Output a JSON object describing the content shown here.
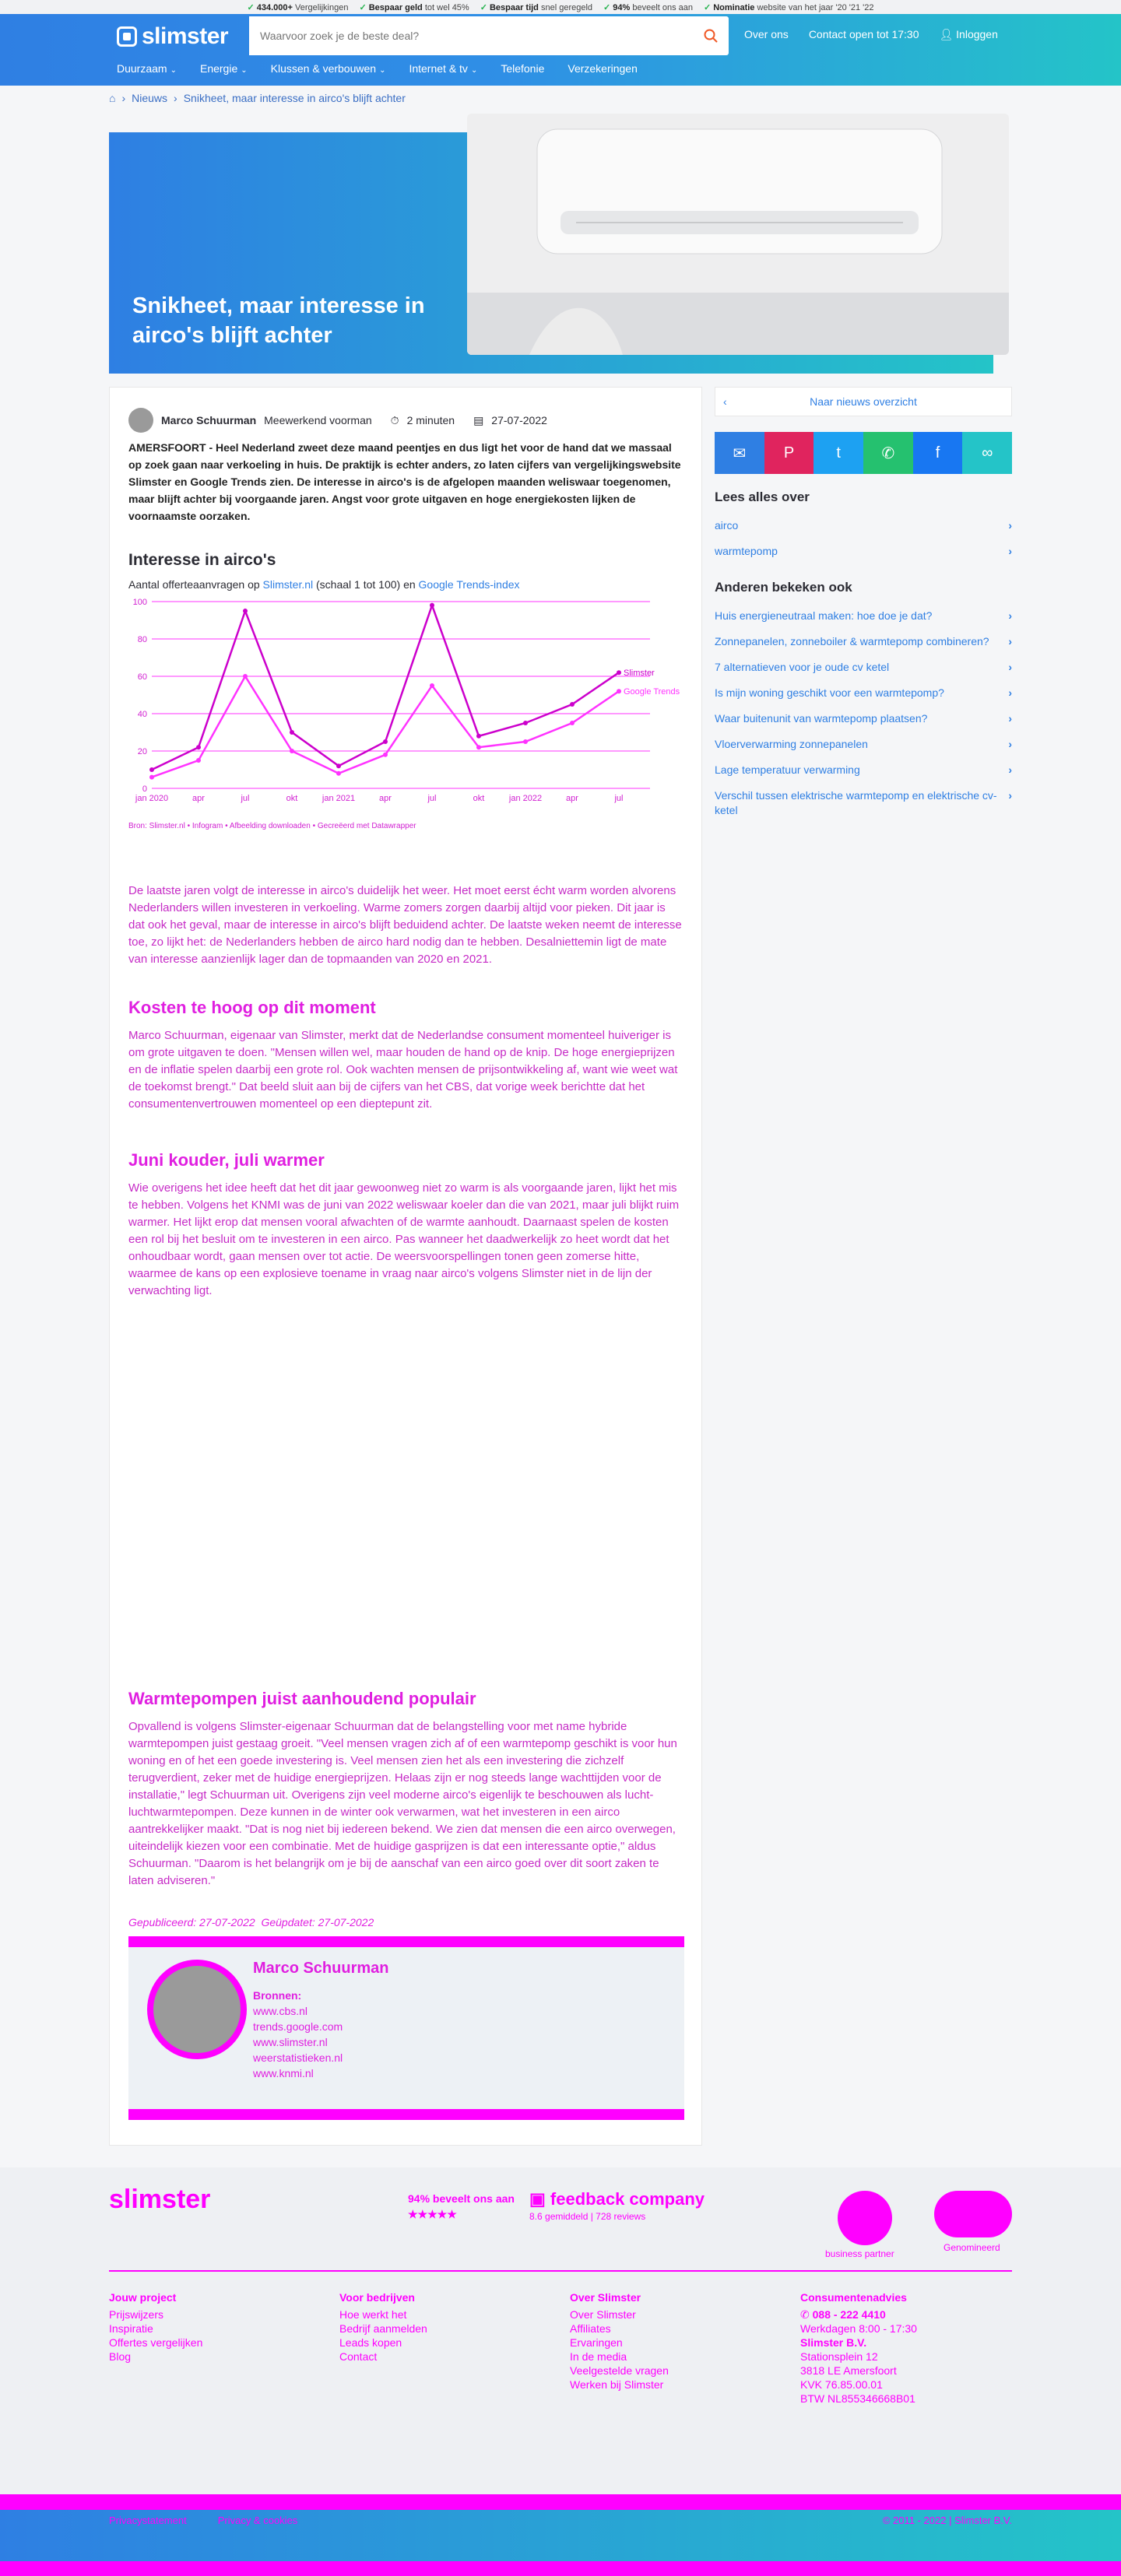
{
  "topbar": [
    {
      "bold": "434.000+",
      "text": "Vergelijkingen"
    },
    {
      "bold": "Bespaar geld",
      "text": "tot wel 45%"
    },
    {
      "bold": "Bespaar tijd",
      "text": "snel geregeld"
    },
    {
      "bold": "94%",
      "text": "beveelt ons aan"
    },
    {
      "bold": "Nominatie",
      "text": "website van het jaar '20 '21 '22"
    }
  ],
  "header": {
    "logo": "slimster",
    "search_placeholder": "Waarvoor zoek je de beste deal?",
    "links": [
      "Over ons",
      "Contact open tot 17:30",
      "Inloggen"
    ],
    "nav": [
      "Duurzaam",
      "Energie",
      "Klussen & verbouwen",
      "Internet & tv",
      "Telefonie",
      "Verzekeringen"
    ]
  },
  "breadcrumb": {
    "items": [
      "Nieuws",
      "Snikheet, maar interesse in airco's blijft achter"
    ]
  },
  "hero": {
    "title": "Snikheet, maar interesse in airco's blijft achter"
  },
  "article": {
    "author": "Marco Schuurman",
    "role": "Meewerkend voorman",
    "read_time": "2 minuten",
    "date": "27-07-2022",
    "intro": "AMERSFOORT - Heel Nederland zweet deze maand peentjes en dus ligt het voor de hand dat we massaal op zoek gaan naar verkoeling in huis. De praktijk is echter anders, zo laten cijfers van vergelijkingswebsite Slimster en Google Trends zien. De interesse in airco's is de afgelopen maanden weliswaar toegenomen, maar blijft achter bij voorgaande jaren. Angst voor grote uitgaven en hoge energiekosten lijken de voornaamste oorzaken.",
    "chart_title": "Interesse in airco's",
    "chart_sub_pre": "Aantal offerteaanvragen op",
    "chart_sub_link1": "Slimster.nl",
    "chart_sub_mid": "(schaal 1 tot 100) en",
    "chart_sub_link2": "Google Trends-index",
    "chart_source": "Bron: Slimster.nl • Infogram • Afbeelding downloaden • Gecreëerd met Datawrapper",
    "p1": "De laatste jaren volgt de interesse in airco's duidelijk het weer. Het moet eerst écht warm worden alvorens Nederlanders willen investeren in verkoeling. Warme zomers zorgen daarbij altijd voor pieken. Dit jaar is dat ook het geval, maar de interesse in airco's blijft beduidend achter. De laatste weken neemt de interesse toe, zo lijkt het: de Nederlanders hebben de airco hard nodig dan te hebben. Desalniettemin ligt de mate van interesse aanzienlijk lager dan de topmaanden van 2020 en 2021.",
    "h_kosten": "Kosten te hoog op dit moment",
    "p2": "Marco Schuurman, eigenaar van Slimster, merkt dat de Nederlandse consument momenteel huiveriger is om grote uitgaven te doen. \"Mensen willen wel, maar houden de hand op de knip. De hoge energieprijzen en de inflatie spelen daarbij een grote rol. Ook wachten mensen de prijsontwikkeling af, want wie weet wat de toekomst brengt.\" Dat beeld sluit aan bij de cijfers van het CBS, dat vorige week berichtte dat het consumentenvertrouwen momenteel op een dieptepunt zit.",
    "h_juni": "Juni kouder, juli warmer",
    "p3": "Wie overigens het idee heeft dat het dit jaar gewoonweg niet zo warm is als voorgaande jaren, lijkt het mis te hebben. Volgens het KNMI was de juni van 2022 weliswaar koeler dan die van 2021, maar juli blijkt ruim warmer. Het lijkt erop dat mensen vooral afwachten of de warmte aanhoudt. Daarnaast spelen de kosten een rol bij het besluit om te investeren in een airco. Pas wanneer het daadwerkelijk zo heet wordt dat het onhoudbaar wordt, gaan mensen over tot actie. De weersvoorspellingen tonen geen zomerse hitte, waarmee de kans op een explosieve toename in vraag naar airco's volgens Slimster niet in de lijn der verwachting ligt.",
    "h_warmte": "Warmtepompen juist aanhoudend populair",
    "p4": "Opvallend is volgens Slimster-eigenaar Schuurman dat de belangstelling voor met name hybride warmtepompen juist gestaag groeit. \"Veel mensen vragen zich af of een warmtepomp geschikt is voor hun woning en of het een goede investering is. Veel mensen zien het als een investering die zichzelf terugverdient, zeker met de huidige energieprijzen. Helaas zijn er nog steeds lange wachttijden voor de installatie,\" legt Schuurman uit. Overigens zijn veel moderne airco's eigenlijk te beschouwen als lucht-luchtwarmtepompen. Deze kunnen in de winter ook verwarmen, wat het investeren in een airco aantrekkelijker maakt. \"Dat is nog niet bij iedereen bekend. We zien dat mensen die een airco overwegen, uiteindelijk kiezen voor een combinatie. Met de huidige gasprijzen is dat een interessante optie,\" aldus Schuurman. \"Daarom is het belangrijk om je bij de aanschaf van een airco goed over dit soort zaken te laten adviseren.\"",
    "published": "Gepubliceerd: 27-07-2022",
    "updated": "Geüpdatet: 27-07-2022",
    "box_name": "Marco Schuurman",
    "box_sources_title": "Bronnen:",
    "box_sources": [
      "www.cbs.nl",
      "trends.google.com",
      "www.slimster.nl",
      "weerstatistieken.nl",
      "www.knmi.nl"
    ]
  },
  "chart_data": {
    "type": "line",
    "title": "Interesse in airco's",
    "x": [
      "jan 2020",
      "apr",
      "jul",
      "okt",
      "jan 2021",
      "apr",
      "jul",
      "okt",
      "jan 2022",
      "apr",
      "jul"
    ],
    "ylim": [
      0,
      100
    ],
    "y_ticks": [
      0,
      20,
      40,
      60,
      80,
      100
    ],
    "series": [
      {
        "name": "Slimster",
        "values": [
          10,
          22,
          95,
          30,
          12,
          25,
          98,
          28,
          35,
          45,
          62
        ]
      },
      {
        "name": "Google Trends",
        "values": [
          6,
          15,
          60,
          20,
          8,
          18,
          55,
          22,
          25,
          35,
          52
        ]
      }
    ],
    "legend": "right"
  },
  "sidebar": {
    "back": "Naar nieuws overzicht",
    "share_icons": [
      "mail-icon",
      "pinterest-icon",
      "twitter-icon",
      "whatsapp-icon",
      "facebook-icon",
      "link-icon"
    ],
    "read_more_title": "Lees alles over",
    "read_more": [
      "airco",
      "warmtepomp"
    ],
    "others_title": "Anderen bekeken ook",
    "others": [
      "Huis energieneutraal maken: hoe doe je dat?",
      "Zonnepanelen, zonneboiler & warmtepomp combineren?",
      "7 alternatieven voor je oude cv ketel",
      "Is mijn woning geschikt voor een warmtepomp?",
      "Waar buitenunit van warmtepomp plaatsen?",
      "Vloerverwarming zonnepanelen",
      "Lage temperatuur verwarming",
      "Verschil tussen elektrische warmtepomp en elektrische cv-ketel"
    ]
  },
  "footer": {
    "logo": "slimster",
    "recommend": "94% beveelt ons aan",
    "fb": "feedback company",
    "fb_rating": "8.6 gemiddeld | 728 reviews",
    "badges": [
      "business partner",
      "Genomineerd"
    ],
    "cols": [
      {
        "title": "Jouw project",
        "items": [
          "Prijswijzers",
          "Inspiratie",
          "Offertes vergelijken",
          "Blog"
        ]
      },
      {
        "title": "Voor bedrijven",
        "items": [
          "Hoe werkt het",
          "Bedrijf aanmelden",
          "Leads kopen",
          "Contact"
        ]
      },
      {
        "title": "Over Slimster",
        "items": [
          "Over Slimster",
          "Affiliates",
          "Ervaringen",
          "In de media",
          "Veelgestelde vragen",
          "Werken bij Slimster"
        ]
      },
      {
        "title": "Consumentenadvies",
        "items": [
          "088 - 222 4410",
          "Werkdagen 8:00 - 17:30",
          "Slimster B.V.",
          "Stationsplein 12",
          "3818 LE Amersfoort",
          "KVK 76.85.00.01",
          "BTW NL855346668B01"
        ]
      }
    ],
    "bottom_left": [
      "Privacystatement",
      "Privacy & cookies"
    ],
    "copyright": "© 2011 - 2022 | Slimster B.V."
  }
}
